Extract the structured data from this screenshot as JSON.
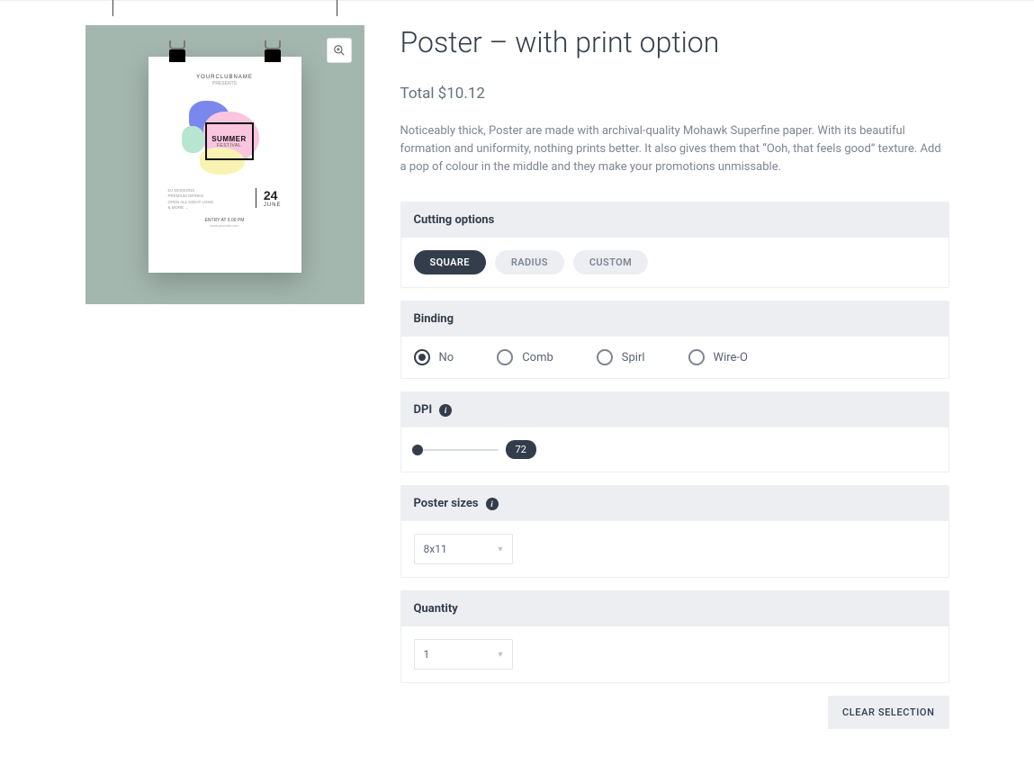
{
  "product": {
    "title": "Poster – with print option",
    "total_label": "Total $10.12",
    "description": "Noticeably thick, Poster are made with archival-quality Mohawk Superfine paper. With its beautiful formation and uniformity, nothing prints better. It also gives them that “Ooh, that feels good” texture. Add a pop of colour in the middle and they make your promotions unmissable."
  },
  "preview": {
    "club": "YOURCLUBNAME",
    "presents": "PRESENTS",
    "art_title": "SUMMER",
    "art_sub": "FESTIVAL",
    "meta": "DJ SESSIONS\nPREMIUM DRINKS\nOPEN ALL NIGHT LONG\n& MORE ...",
    "date_num": "24",
    "date_month": "JUNE",
    "entry": "ENTRY AT 9.00 PM",
    "site": "www.yoursite.com"
  },
  "cutting": {
    "heading": "Cutting options",
    "options": [
      "SQUARE",
      "RADIUS",
      "CUSTOM"
    ],
    "selected": "SQUARE"
  },
  "binding": {
    "heading": "Binding",
    "options": [
      "No",
      "Comb",
      "Spirl",
      "Wire-O"
    ],
    "selected": "No"
  },
  "dpi": {
    "heading": "DPI",
    "value": "72"
  },
  "sizes": {
    "heading": "Poster sizes",
    "selected": "8x11"
  },
  "quantity": {
    "heading": "Quantity",
    "selected": "1"
  },
  "actions": {
    "clear": "CLEAR SELECTION"
  }
}
